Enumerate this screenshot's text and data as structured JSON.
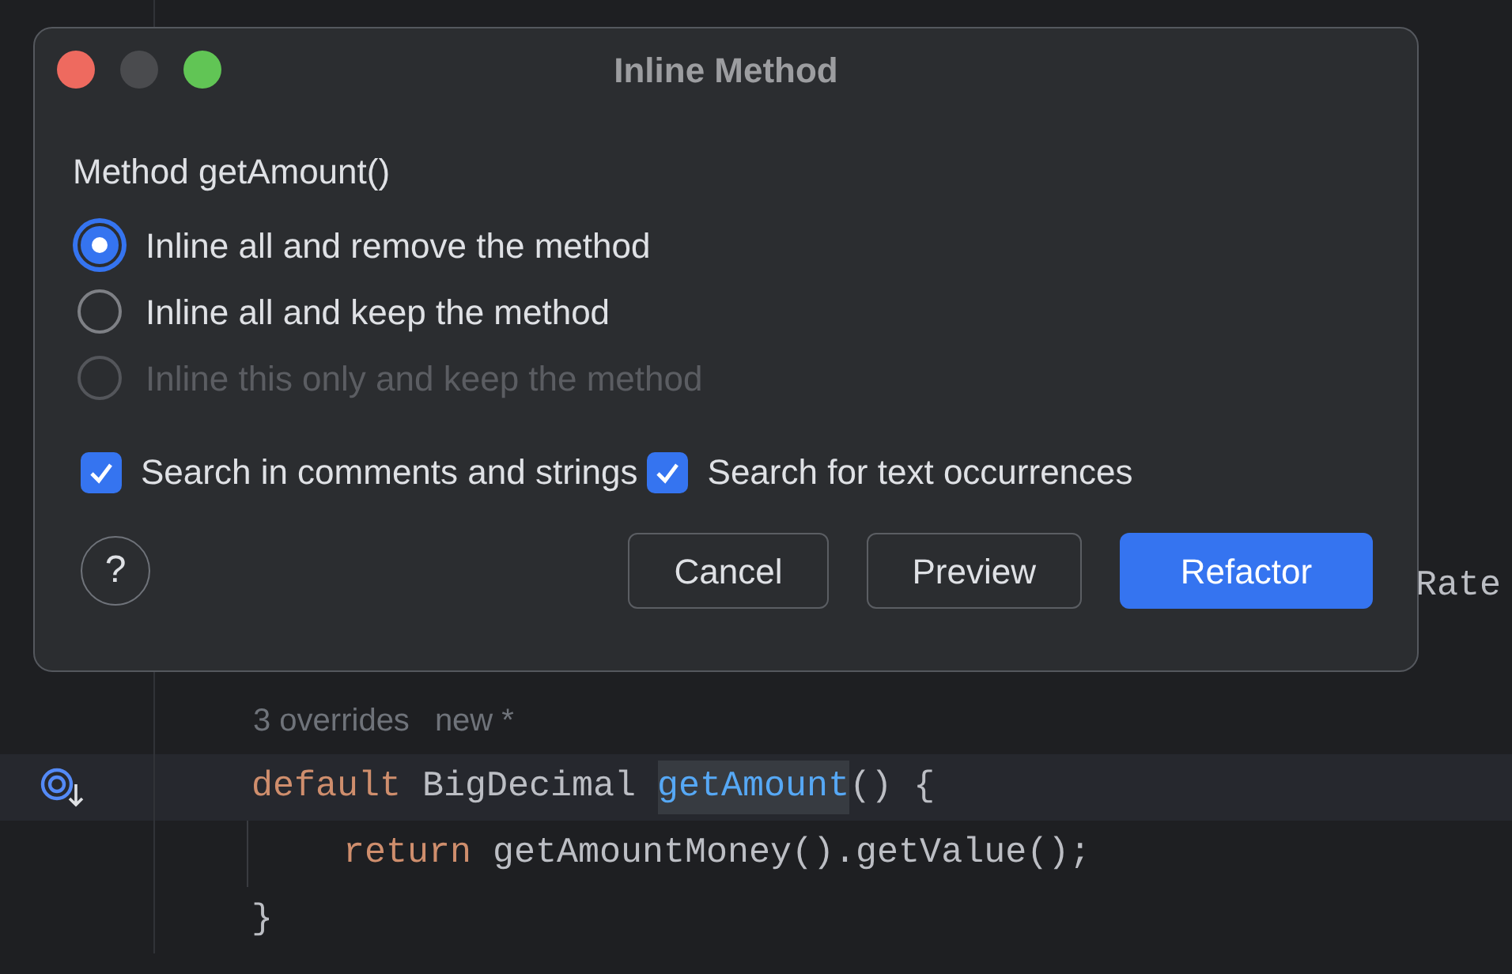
{
  "editor": {
    "partial_line": {
      "text": "Rate"
    },
    "inlay_hint": [
      "3 overrides",
      "new *"
    ],
    "lines": [
      {
        "highlighted": true,
        "gutter_marker": true,
        "indent_guide": false,
        "tokens": [
          {
            "text": "default",
            "kind": "keyword"
          },
          {
            "text": " BigDecimal ",
            "kind": "plain"
          },
          {
            "text": "getAmount",
            "kind": "usage"
          },
          {
            "text": "() {",
            "kind": "plain"
          }
        ]
      },
      {
        "highlighted": false,
        "gutter_marker": false,
        "indent_guide": true,
        "tokens": [
          {
            "text": "return",
            "kind": "keyword"
          },
          {
            "text": " getAmountMoney().getValue();",
            "kind": "plain"
          }
        ]
      },
      {
        "highlighted": false,
        "gutter_marker": false,
        "indent_guide": false,
        "tokens": [
          {
            "text": "}",
            "kind": "plain"
          }
        ]
      }
    ]
  },
  "dialog": {
    "title": "Inline Method",
    "label": "Method getAmount()",
    "options": [
      {
        "label": "Inline all and remove the method",
        "selected": true,
        "disabled": false
      },
      {
        "label": "Inline all and keep the method",
        "selected": false,
        "disabled": false
      },
      {
        "label": "Inline this only and keep the method",
        "selected": false,
        "disabled": true
      }
    ],
    "checkboxes": [
      {
        "label": "Search in comments and strings",
        "checked": true
      },
      {
        "label": "Search for text occurrences",
        "checked": true
      }
    ],
    "help": "?",
    "buttons": [
      {
        "label": "Cancel",
        "kind": "secondary"
      },
      {
        "label": "Preview",
        "kind": "secondary"
      },
      {
        "label": "Refactor",
        "kind": "primary"
      }
    ]
  }
}
